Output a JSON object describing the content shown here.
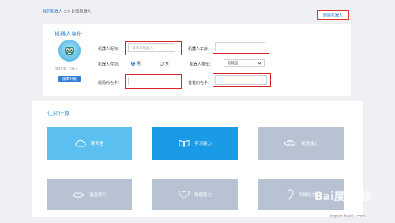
{
  "breadcrumb": {
    "link": "我的机器人",
    "separator": " >> ",
    "current": "配置机器人"
  },
  "header": {
    "delete_button": "删除机器人"
  },
  "identity": {
    "title": "机器人身份",
    "avatar_caption": "暂未配置 · 机器人",
    "version_button": "版本升级",
    "name_label": "机器人昵称：",
    "name_placeholder": "请填写机器人",
    "age_label": "机器人年龄：",
    "gender_label": "机器人性别：",
    "gender_options": [
      "男",
      "女"
    ],
    "gender_selected": "男",
    "type_label": "机器人类型：",
    "type_value": "智能型",
    "dad_label": "妈妈的名字：",
    "mom_label": "爸爸的名字："
  },
  "cognition": {
    "title": "认知计算",
    "tiles": [
      {
        "label": "聊天室",
        "icon": "cloud-chat-icon",
        "color": "#5bc0f0"
      },
      {
        "label": "学习能力",
        "icon": "book-icon",
        "color": "#199be6"
      },
      {
        "label": "视觉能力",
        "icon": "eye-icon",
        "color": "#b7c2d3"
      },
      {
        "label": "语音能力",
        "icon": "lips-icon",
        "color": "#b7c2d3"
      },
      {
        "label": "情感能力",
        "icon": "heart-icon",
        "color": "#b7c2d3"
      },
      {
        "label": "听觉能力",
        "icon": "ear-icon",
        "color": "#b7c2d3"
      }
    ]
  },
  "watermark": {
    "brand": "Bai度 经验",
    "url": "jingyan.baidu.com"
  }
}
